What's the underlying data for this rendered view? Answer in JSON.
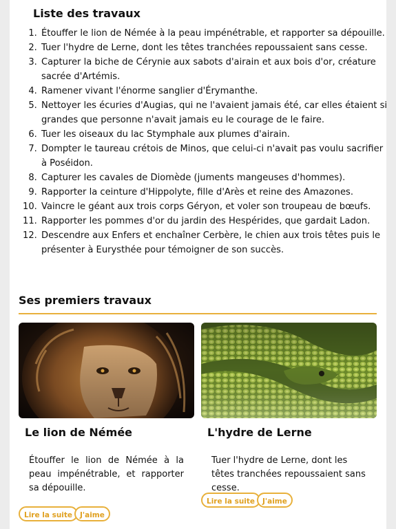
{
  "list_title": "Liste des travaux",
  "travaux": [
    "Étouffer le lion de Némée à la peau impénétrable, et rapporter sa dépouille.",
    "Tuer l'hydre de Lerne, dont les têtes tranchées repoussaient sans cesse.",
    "Capturer la biche de Cérynie aux sabots d'airain et aux bois d'or, créature sacrée d'Artémis.",
    "Ramener vivant l'énorme sanglier d'Érymanthe.",
    "Nettoyer les écuries d'Augias, qui ne l'avaient jamais été, car elles étaient si grandes que personne n'avait jamais eu le courage de le faire.",
    "Tuer les oiseaux du lac Stymphale aux plumes d'airain.",
    "Dompter le taureau crétois de Minos, que celui-ci n'avait pas voulu sacrifier à Poséidon.",
    "Capturer les cavales de Diomède (juments mangeuses d'hommes).",
    "Rapporter la ceinture d'Hippolyte, fille d'Arès et reine des Amazones.",
    "Vaincre le géant aux trois corps Géryon, et voler son troupeau de bœufs.",
    "Rapporter les pommes d'or du jardin des Hespérides, que gardait Ladon.",
    "Descendre aux Enfers et enchaîner Cerbère, le chien aux trois têtes puis le présenter à Eurysthée pour témoigner de son succès."
  ],
  "section_title": "Ses premiers travaux",
  "cards": [
    {
      "title": "Le lion de Némée",
      "text": "Étouffer le lion de Némée à la peau impénétrable, et rapporter sa dépouille.",
      "read_more": "Lire la suite",
      "like": "J'aime",
      "image": "lion-photo"
    },
    {
      "title": "L'hydre de Lerne",
      "text": "Tuer l'hydre de Lerne, dont les têtes tranchées repoussaient sans cesse.",
      "read_more": "Lire la suite",
      "like": "J'aime",
      "image": "snake-photo"
    }
  ],
  "colors": {
    "accent": "#e8b03a",
    "accent_text": "#e0a020"
  }
}
